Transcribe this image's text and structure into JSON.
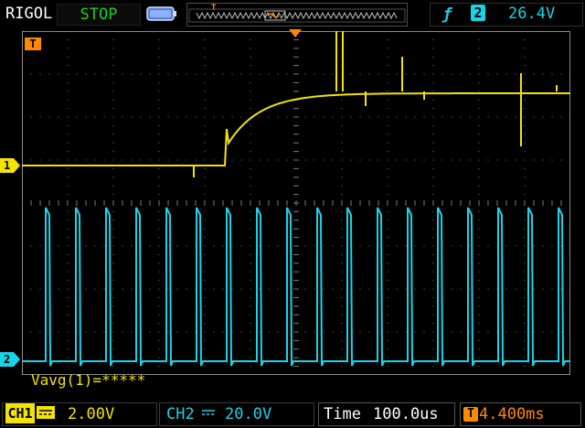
{
  "status": {
    "brand": "RIGOL",
    "run_state": "STOP"
  },
  "trigger": {
    "channel": "2",
    "level": "26.4V",
    "edge_icon": "rising-edge-icon"
  },
  "channels": {
    "ch1": {
      "label": "CH1",
      "scale": "2.00V",
      "marker": "1",
      "color": "#f3e300"
    },
    "ch2": {
      "label": "CH2",
      "scale": "20.0V",
      "marker": "2",
      "color": "#19d3e8"
    }
  },
  "timebase": {
    "label": "Time",
    "value": "100.0us"
  },
  "trigger_offset": {
    "value": "4.400ms",
    "icon_label": "T"
  },
  "measurement": {
    "text": "Vavg(1)=*****"
  },
  "markers": {
    "trigger_T": "T"
  },
  "colors": {
    "grid": "#7f7f7f",
    "accent_orange": "#ff8a00"
  }
}
